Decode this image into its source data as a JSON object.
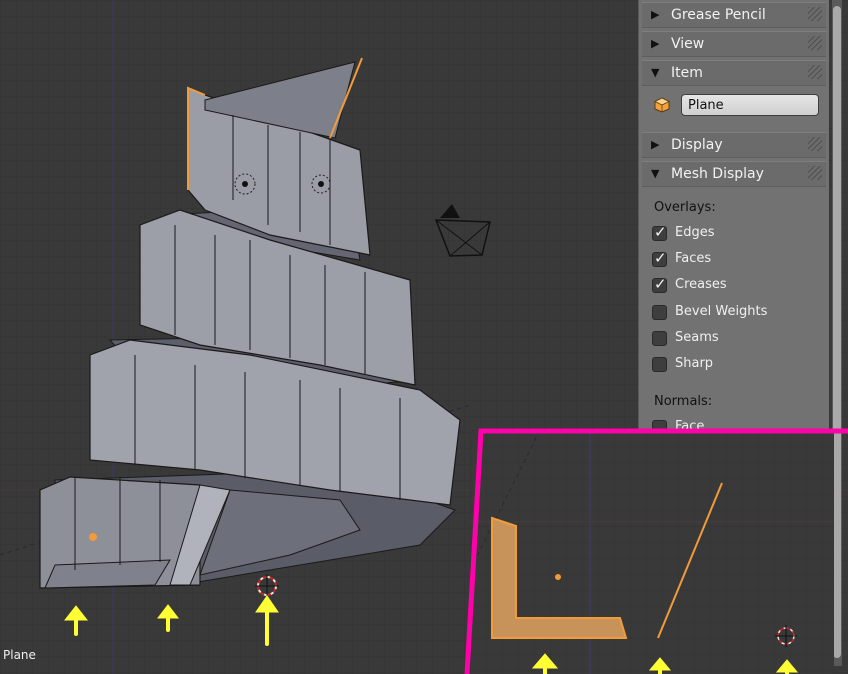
{
  "panel": {
    "sections": {
      "grease_pencil": "Grease Pencil",
      "view": "View",
      "item": "Item",
      "display": "Display",
      "mesh_display": "Mesh Display"
    },
    "item_name": "Plane",
    "overlays_label": "Overlays:",
    "overlays": [
      {
        "label": "Edges",
        "checked": true
      },
      {
        "label": "Faces",
        "checked": true
      },
      {
        "label": "Creases",
        "checked": true
      },
      {
        "label": "Bevel Weights",
        "checked": false
      },
      {
        "label": "Seams",
        "checked": false
      },
      {
        "label": "Sharp",
        "checked": false
      }
    ],
    "normals_label": "Normals:",
    "normals_first": "Face"
  },
  "viewport": {
    "object_name": "Plane"
  },
  "colors": {
    "background": "#393939",
    "panel": "#727272",
    "mesh_face": "#8a8d98",
    "selected_edge": "#f29b3b",
    "highlight_border": "#ff00aa",
    "arrow": "#ffff33"
  },
  "icons": [
    "collapse-triangle-icon",
    "expand-triangle-icon",
    "mesh-object-icon",
    "checkmark-icon",
    "camera-icon",
    "3d-cursor-icon",
    "origin-dot-icon",
    "annotation-arrow-icon"
  ]
}
